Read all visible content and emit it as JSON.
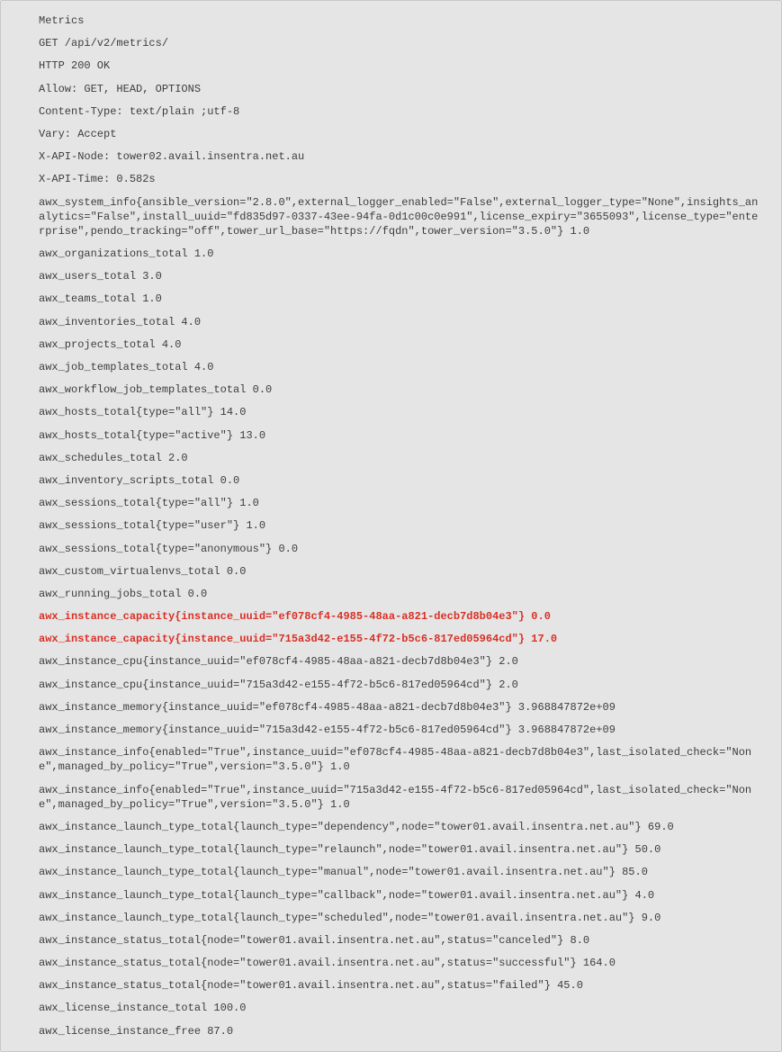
{
  "lines": [
    {
      "text": "Metrics"
    },
    {
      "text": "GET /api/v2/metrics/"
    },
    {
      "text": "HTTP 200 OK"
    },
    {
      "text": "Allow: GET, HEAD, OPTIONS"
    },
    {
      "text": "Content-Type: text/plain ;utf-8"
    },
    {
      "text": "Vary: Accept"
    },
    {
      "text": "X-API-Node: tower02.avail.insentra.net.au"
    },
    {
      "text": "X-API-Time: 0.582s"
    },
    {
      "text": "awx_system_info{ansible_version=\"2.8.0\",external_logger_enabled=\"False\",external_logger_type=\"None\",insights_analytics=\"False\",install_uuid=\"fd835d97-0337-43ee-94fa-0d1c00c0e991\",license_expiry=\"3655093\",license_type=\"enterprise\",pendo_tracking=\"off\",tower_url_base=\"https://fqdn\",tower_version=\"3.5.0\"} 1.0"
    },
    {
      "text": "awx_organizations_total 1.0"
    },
    {
      "text": "awx_users_total 3.0"
    },
    {
      "text": "awx_teams_total 1.0"
    },
    {
      "text": "awx_inventories_total 4.0"
    },
    {
      "text": "awx_projects_total 4.0"
    },
    {
      "text": "awx_job_templates_total 4.0"
    },
    {
      "text": "awx_workflow_job_templates_total 0.0"
    },
    {
      "text": "awx_hosts_total{type=\"all\"} 14.0"
    },
    {
      "text": "awx_hosts_total{type=\"active\"} 13.0"
    },
    {
      "text": "awx_schedules_total 2.0"
    },
    {
      "text": "awx_inventory_scripts_total 0.0"
    },
    {
      "text": "awx_sessions_total{type=\"all\"} 1.0"
    },
    {
      "text": "awx_sessions_total{type=\"user\"} 1.0"
    },
    {
      "text": "awx_sessions_total{type=\"anonymous\"} 0.0"
    },
    {
      "text": "awx_custom_virtualenvs_total 0.0"
    },
    {
      "text": "awx_running_jobs_total 0.0"
    },
    {
      "text": "awx_instance_capacity{instance_uuid=\"ef078cf4-4985-48aa-a821-decb7d8b04e3\"} 0.0",
      "highlight": true
    },
    {
      "text": "awx_instance_capacity{instance_uuid=\"715a3d42-e155-4f72-b5c6-817ed05964cd\"} 17.0",
      "highlight": true
    },
    {
      "text": "awx_instance_cpu{instance_uuid=\"ef078cf4-4985-48aa-a821-decb7d8b04e3\"} 2.0"
    },
    {
      "text": "awx_instance_cpu{instance_uuid=\"715a3d42-e155-4f72-b5c6-817ed05964cd\"} 2.0"
    },
    {
      "text": "awx_instance_memory{instance_uuid=\"ef078cf4-4985-48aa-a821-decb7d8b04e3\"} 3.968847872e+09"
    },
    {
      "text": "awx_instance_memory{instance_uuid=\"715a3d42-e155-4f72-b5c6-817ed05964cd\"} 3.968847872e+09"
    },
    {
      "text": "awx_instance_info{enabled=\"True\",instance_uuid=\"ef078cf4-4985-48aa-a821-decb7d8b04e3\",last_isolated_check=\"None\",managed_by_policy=\"True\",version=\"3.5.0\"} 1.0"
    },
    {
      "text": "awx_instance_info{enabled=\"True\",instance_uuid=\"715a3d42-e155-4f72-b5c6-817ed05964cd\",last_isolated_check=\"None\",managed_by_policy=\"True\",version=\"3.5.0\"} 1.0"
    },
    {
      "text": "awx_instance_launch_type_total{launch_type=\"dependency\",node=\"tower01.avail.insentra.net.au\"} 69.0"
    },
    {
      "text": "awx_instance_launch_type_total{launch_type=\"relaunch\",node=\"tower01.avail.insentra.net.au\"} 50.0"
    },
    {
      "text": "awx_instance_launch_type_total{launch_type=\"manual\",node=\"tower01.avail.insentra.net.au\"} 85.0"
    },
    {
      "text": "awx_instance_launch_type_total{launch_type=\"callback\",node=\"tower01.avail.insentra.net.au\"} 4.0"
    },
    {
      "text": "awx_instance_launch_type_total{launch_type=\"scheduled\",node=\"tower01.avail.insentra.net.au\"} 9.0"
    },
    {
      "text": "awx_instance_status_total{node=\"tower01.avail.insentra.net.au\",status=\"canceled\"} 8.0"
    },
    {
      "text": "awx_instance_status_total{node=\"tower01.avail.insentra.net.au\",status=\"successful\"} 164.0"
    },
    {
      "text": "awx_instance_status_total{node=\"tower01.avail.insentra.net.au\",status=\"failed\"} 45.0"
    },
    {
      "text": "awx_license_instance_total 100.0"
    },
    {
      "text": "awx_license_instance_free 87.0"
    }
  ]
}
